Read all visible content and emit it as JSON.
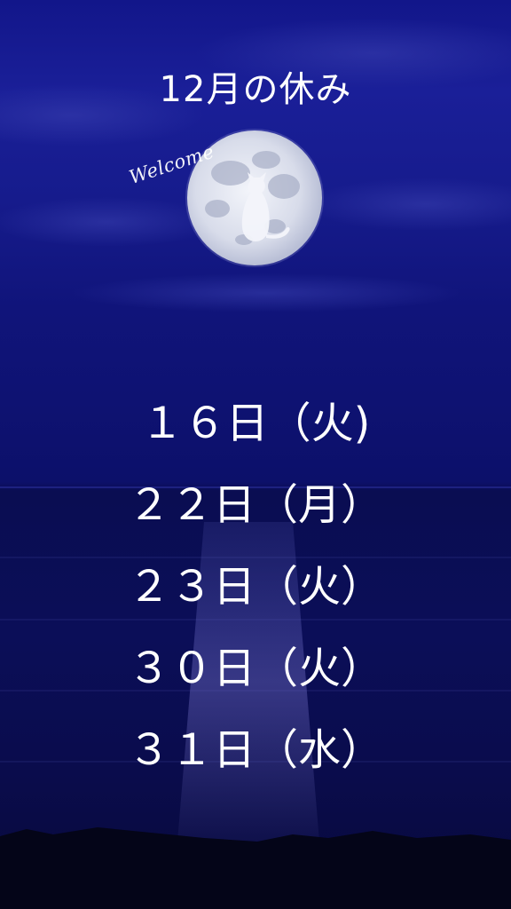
{
  "title": "12月の休み",
  "moon_caption": "Welcome",
  "holidays": [
    "１６日（火)",
    "２２日（月）",
    "２３日（火）",
    "３０日（火）",
    "３１日（水）"
  ],
  "colors": {
    "sky": "#161b8c",
    "sea": "#0b0e58",
    "moon": "#dfe3ee",
    "text": "#ffffff"
  },
  "icons": [
    "full-moon-icon",
    "cat-silhouette-icon"
  ]
}
